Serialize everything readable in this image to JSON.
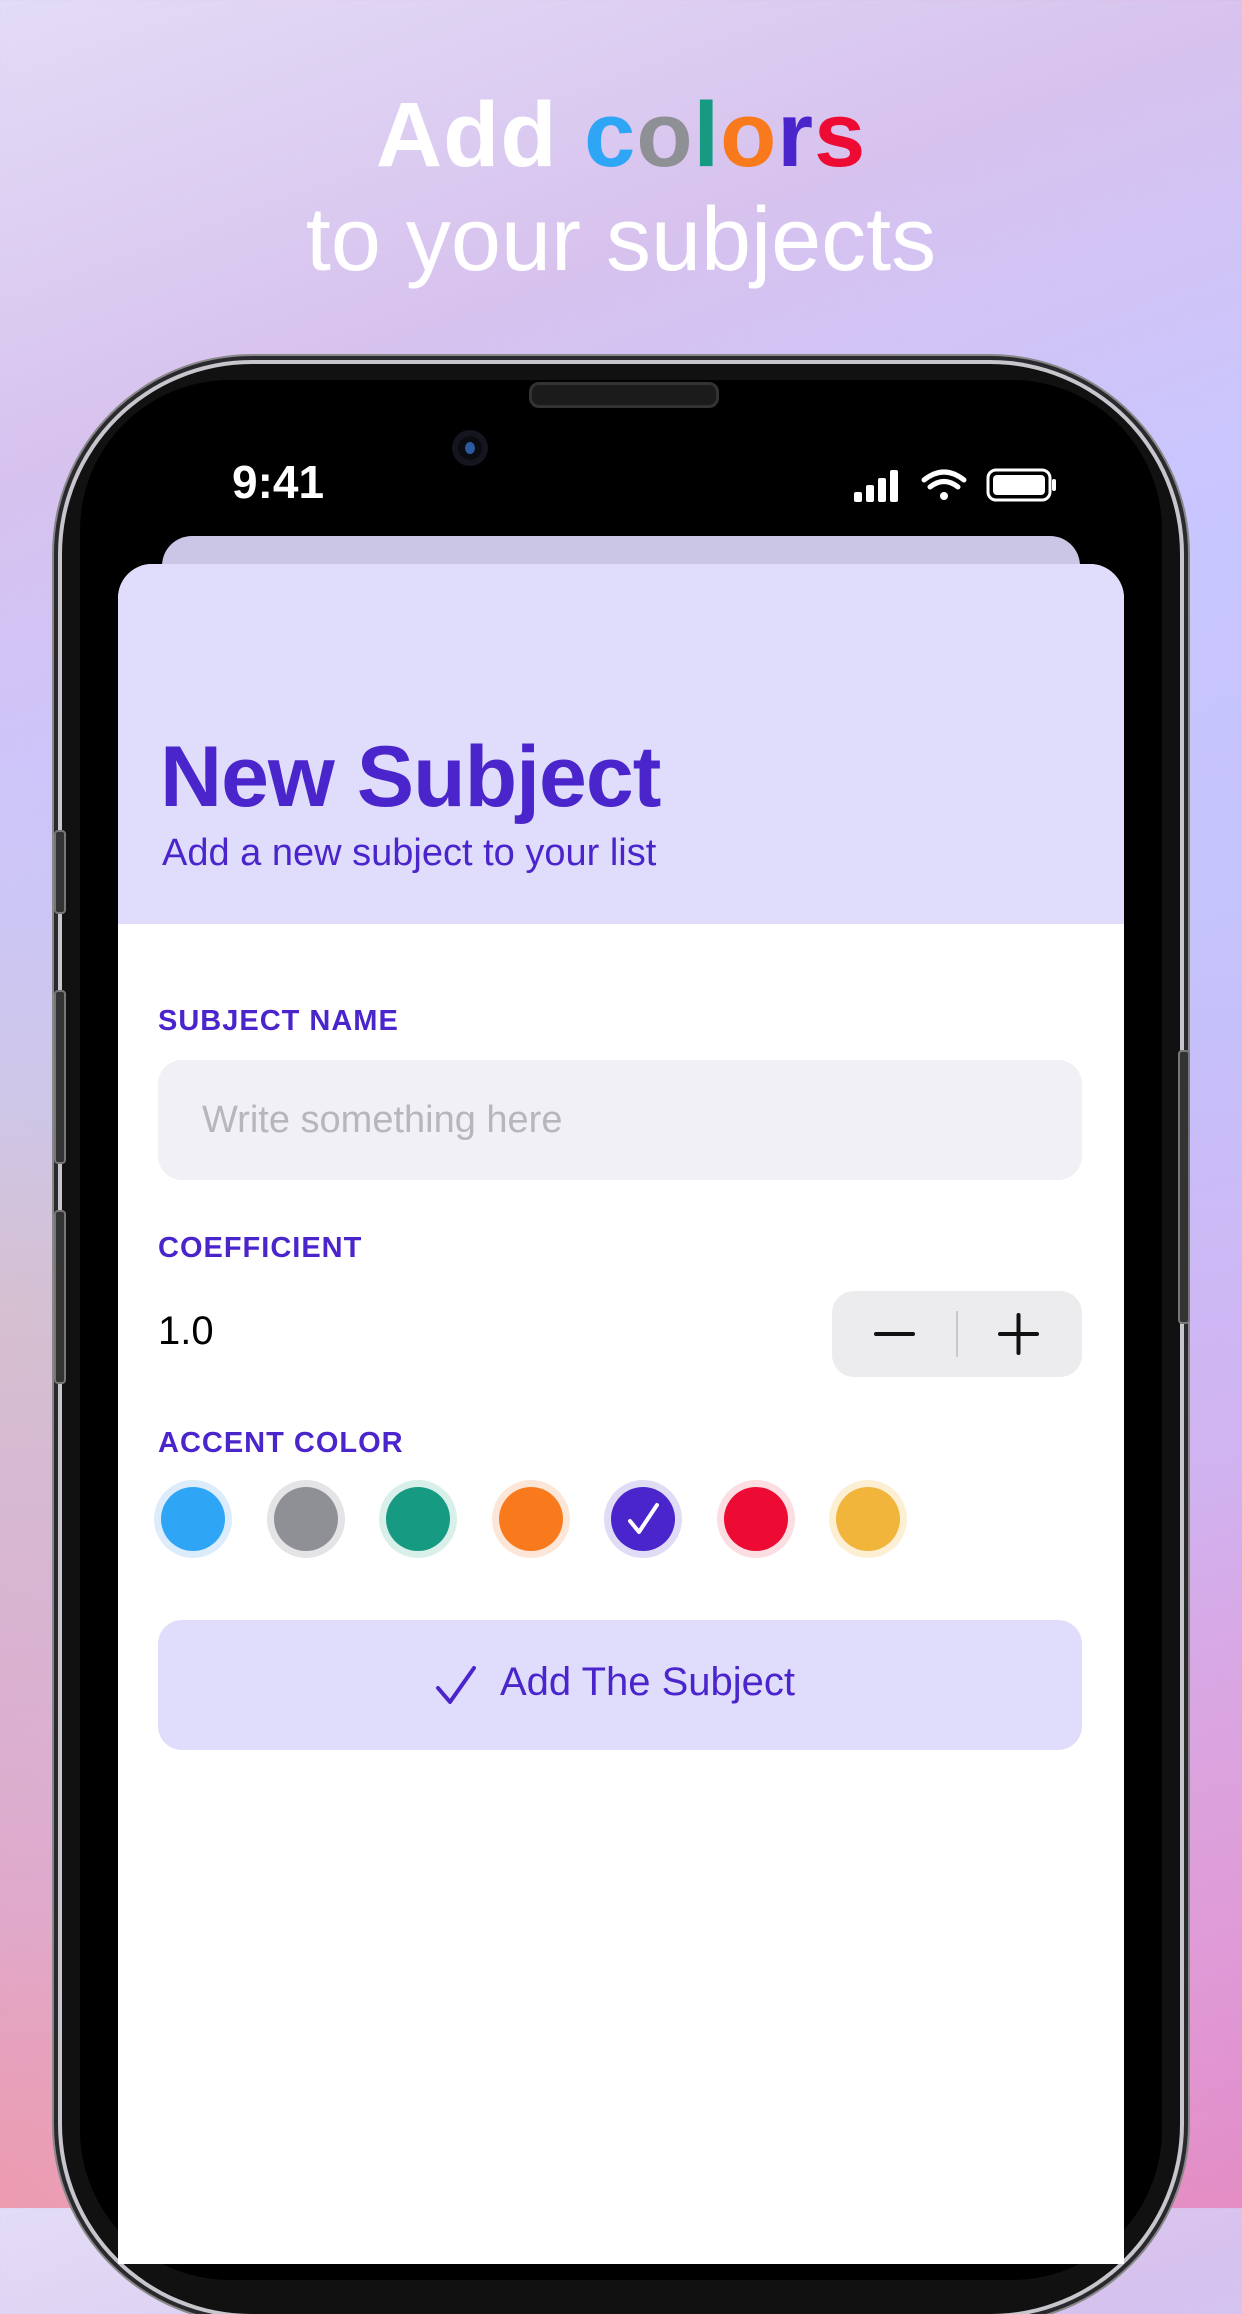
{
  "headline": {
    "line1_word": "Add",
    "line1_letters": [
      {
        "ch": "c",
        "color": "#2fa6f5"
      },
      {
        "ch": "o",
        "color": "#8f8f96"
      },
      {
        "ch": "l",
        "color": "#169a82"
      },
      {
        "ch": "o",
        "color": "#f97a1c"
      },
      {
        "ch": "r",
        "color": "#4b25cc"
      },
      {
        "ch": "s",
        "color": "#ee0b33"
      }
    ],
    "line2": "to your subjects"
  },
  "status_bar": {
    "time": "9:41",
    "icons": [
      "signal-icon",
      "wifi-icon",
      "battery-icon"
    ]
  },
  "sheet": {
    "title": "New Subject",
    "subtitle": "Add a new subject to your list",
    "subject_name": {
      "label": "SUBJECT NAME",
      "placeholder": "Write something here",
      "value": ""
    },
    "coefficient": {
      "label": "COEFFICIENT",
      "value": "1.0",
      "decrement_icon": "minus-icon",
      "increment_icon": "plus-icon"
    },
    "accent_color": {
      "label": "ACCENT COLOR",
      "options": [
        {
          "name": "blue",
          "color": "#2fa6f5",
          "ring": "#dcecfb"
        },
        {
          "name": "gray",
          "color": "#8f8f96",
          "ring": "#e4e4e7"
        },
        {
          "name": "teal",
          "color": "#169a82",
          "ring": "#d9efe9"
        },
        {
          "name": "orange",
          "color": "#f97a1c",
          "ring": "#fce6d7"
        },
        {
          "name": "purple",
          "color": "#4b25cc",
          "ring": "#e0dcf6",
          "selected": true
        },
        {
          "name": "red",
          "color": "#ee0b33",
          "ring": "#fbdde2"
        },
        {
          "name": "yellow",
          "color": "#f2b53c",
          "ring": "#fcefd3"
        }
      ]
    },
    "submit": {
      "label": "Add The Subject",
      "icon": "checkmark-icon"
    }
  },
  "colors": {
    "accent": "#4b25cc",
    "header_bg": "#e0dcfb",
    "input_bg": "#f0f0f5"
  }
}
